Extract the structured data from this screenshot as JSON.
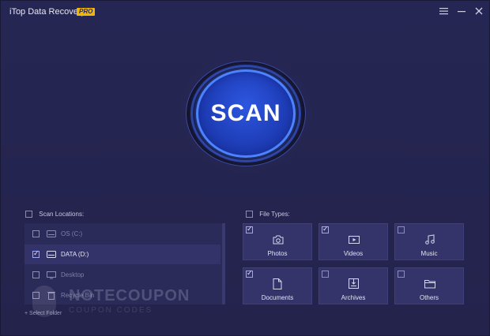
{
  "app": {
    "title": "iTop Data Recovery",
    "badge": "PRO"
  },
  "window_controls": {
    "menu_icon": "hamburger-icon",
    "minimize_icon": "minimize-icon",
    "close_icon": "close-icon"
  },
  "scan": {
    "label": "SCAN"
  },
  "scan_locations": {
    "heading": "Scan Locations:",
    "select_all_checked": false,
    "items": [
      {
        "label": "OS (C:)",
        "icon": "drive-icon",
        "checked": false,
        "selected": false
      },
      {
        "label": "DATA (D:)",
        "icon": "drive-icon",
        "checked": true,
        "selected": true
      },
      {
        "label": "Desktop",
        "icon": "monitor-icon",
        "checked": false,
        "selected": false
      },
      {
        "label": "Recycle Bin",
        "icon": "trash-icon",
        "checked": false,
        "selected": false
      }
    ],
    "select_folder": "+ Select Folder"
  },
  "file_types": {
    "heading": "File Types:",
    "select_all_checked": false,
    "items": [
      {
        "label": "Photos",
        "icon": "camera-icon",
        "checked": true
      },
      {
        "label": "Videos",
        "icon": "video-icon",
        "checked": true
      },
      {
        "label": "Music",
        "icon": "music-icon",
        "checked": false
      },
      {
        "label": "Documents",
        "icon": "document-icon",
        "checked": true
      },
      {
        "label": "Archives",
        "icon": "archive-icon",
        "checked": false
      },
      {
        "label": "Others",
        "icon": "folder-icon",
        "checked": false
      }
    ]
  },
  "watermark": {
    "text": "NOTECOUPON",
    "subtext": "COUPON CODES"
  },
  "colors": {
    "background": "#24244e",
    "accent": "#2d56e0",
    "badge": "#f2b705",
    "tile": "#34346a"
  }
}
